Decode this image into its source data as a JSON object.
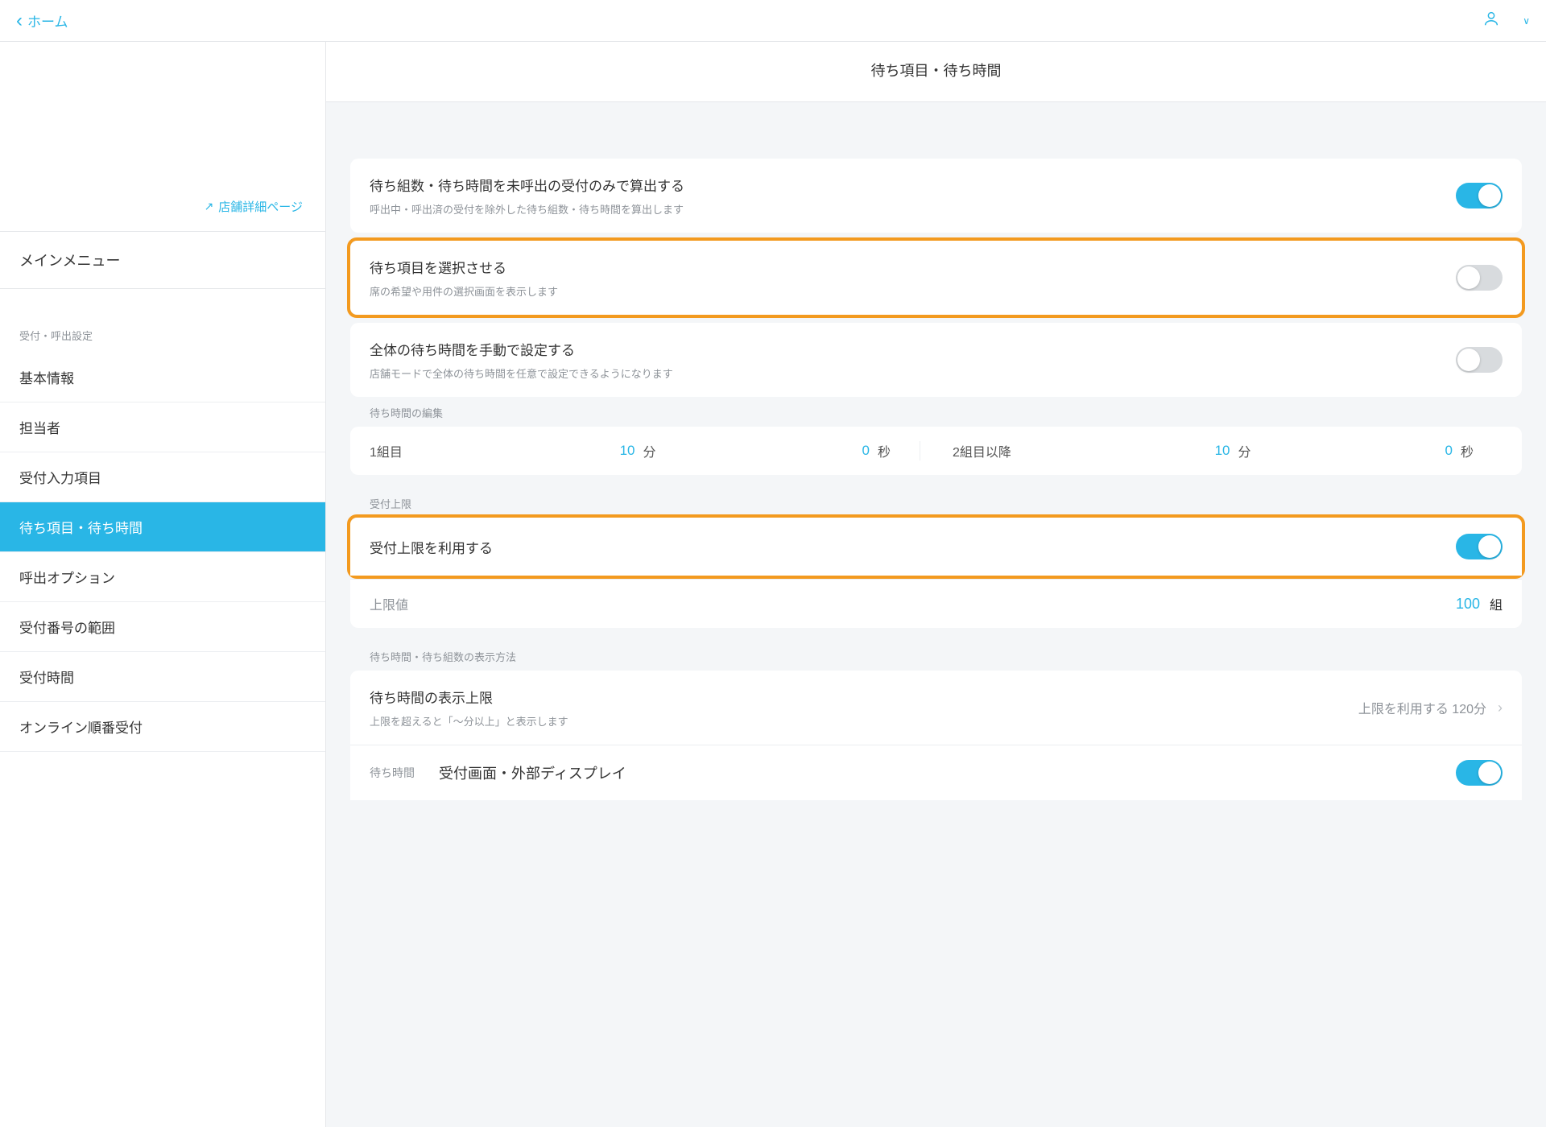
{
  "topbar": {
    "back": "ホーム"
  },
  "sidebar": {
    "store_link": "店舗詳細ページ",
    "main_menu": "メインメニュー",
    "section_label": "受付・呼出設定",
    "items": [
      "基本情報",
      "担当者",
      "受付入力項目",
      "待ち項目・待ち時間",
      "呼出オプション",
      "受付番号の範囲",
      "受付時間",
      "オンライン順番受付"
    ]
  },
  "page": {
    "title": "待ち項目・待ち時間"
  },
  "card1": {
    "title": "待ち組数・待ち時間を未呼出の受付のみで算出する",
    "sub": "呼出中・呼出済の受付を除外した待ち組数・待ち時間を算出します"
  },
  "card2": {
    "title": "待ち項目を選択させる",
    "sub": "席の希望や用件の選択画面を表示します"
  },
  "card3": {
    "title": "全体の待ち時間を手動で設定する",
    "sub": "店舗モードで全体の待ち時間を任意で設定できるようになります"
  },
  "wait_edit": {
    "label": "待ち時間の編集",
    "g1_label": "1組目",
    "g1_min": "10",
    "g1_min_u": "分",
    "g1_sec": "0",
    "g1_sec_u": "秒",
    "g2_label": "2組目以降",
    "g2_min": "10",
    "g2_min_u": "分",
    "g2_sec": "0",
    "g2_sec_u": "秒"
  },
  "limit": {
    "sect": "受付上限",
    "use_title": "受付上限を利用する",
    "val_label": "上限値",
    "val": "100",
    "unit": "組"
  },
  "display": {
    "sect": "待ち時間・待ち組数の表示方法",
    "r1_title": "待ち時間の表示上限",
    "r1_sub": "上限を超えると「～分以上」と表示します",
    "r1_right": "上限を利用する 120分",
    "r2_label": "待ち時間",
    "r2_val": "受付画面・外部ディスプレイ"
  }
}
